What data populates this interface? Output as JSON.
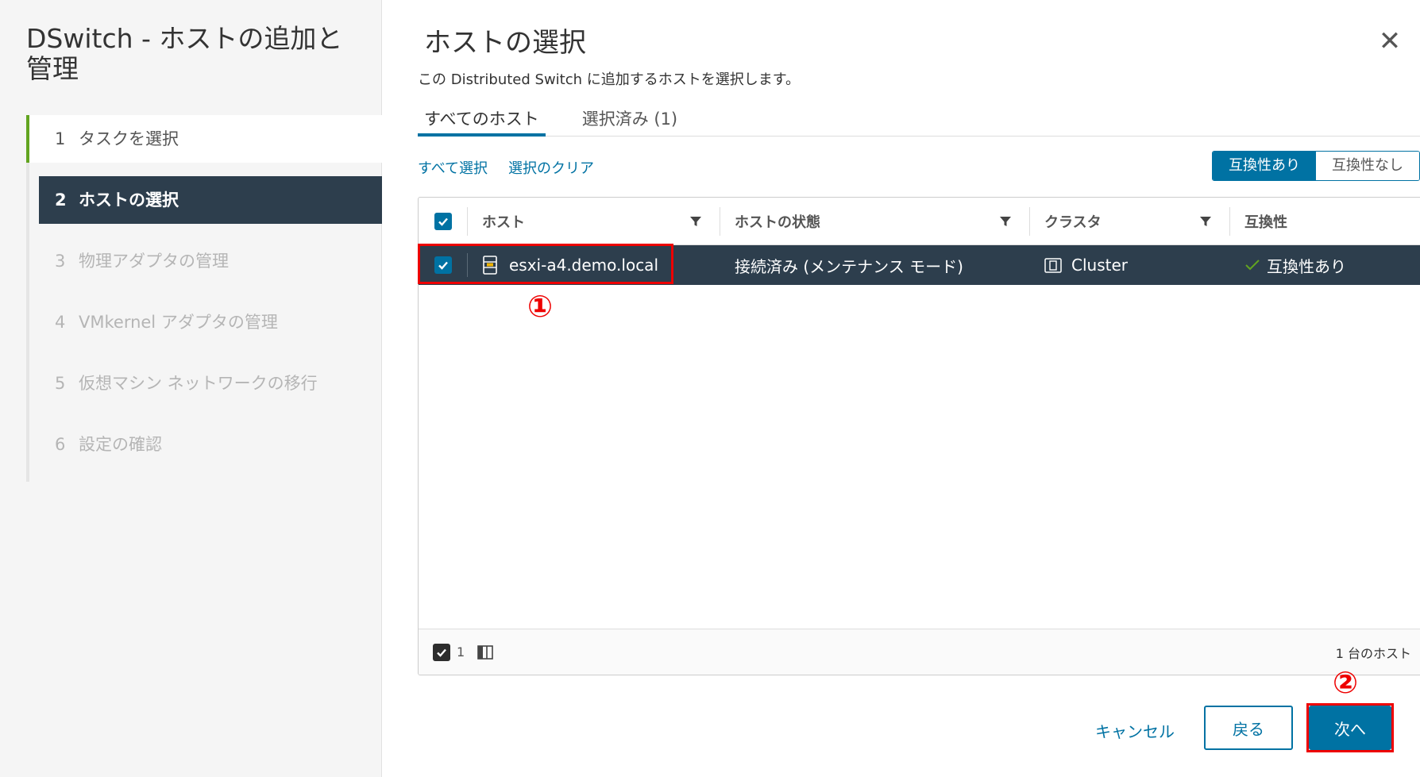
{
  "wizard": {
    "title": "DSwitch - ホストの追加と管理",
    "steps": [
      {
        "num": "1",
        "label": "タスクを選択"
      },
      {
        "num": "2",
        "label": "ホストの選択"
      },
      {
        "num": "3",
        "label": "物理アダプタの管理"
      },
      {
        "num": "4",
        "label": "VMkernel アダプタの管理"
      },
      {
        "num": "5",
        "label": "仮想マシン ネットワークの移行"
      },
      {
        "num": "6",
        "label": "設定の確認"
      }
    ]
  },
  "main": {
    "title": "ホストの選択",
    "description": "この Distributed Switch に追加するホストを選択します。",
    "close_icon": "close-icon",
    "tabs": [
      {
        "label": "すべてのホスト"
      },
      {
        "label": "選択済み (1)"
      }
    ],
    "select_all": "すべて選択",
    "clear_selection": "選択のクリア",
    "toggle": {
      "compatible": "互換性あり",
      "incompatible": "互換性なし"
    },
    "grid": {
      "columns": [
        "ホスト",
        "ホストの状態",
        "クラスタ",
        "互換性"
      ],
      "rows": [
        {
          "host": "esxi-a4.demo.local",
          "state": "接続済み (メンテナンス モード)",
          "cluster": "Cluster",
          "compat": "互換性あり"
        }
      ],
      "footer_count": "1",
      "footer_total": "1 台のホスト"
    },
    "markers": {
      "one": "①",
      "two": "②"
    }
  },
  "buttons": {
    "cancel": "キャンセル",
    "back": "戻る",
    "next": "次へ"
  },
  "colors": {
    "accent": "#0072a3",
    "selected_row": "#2d3e4d",
    "highlight": "#e00000",
    "progress_done": "#62a420"
  }
}
